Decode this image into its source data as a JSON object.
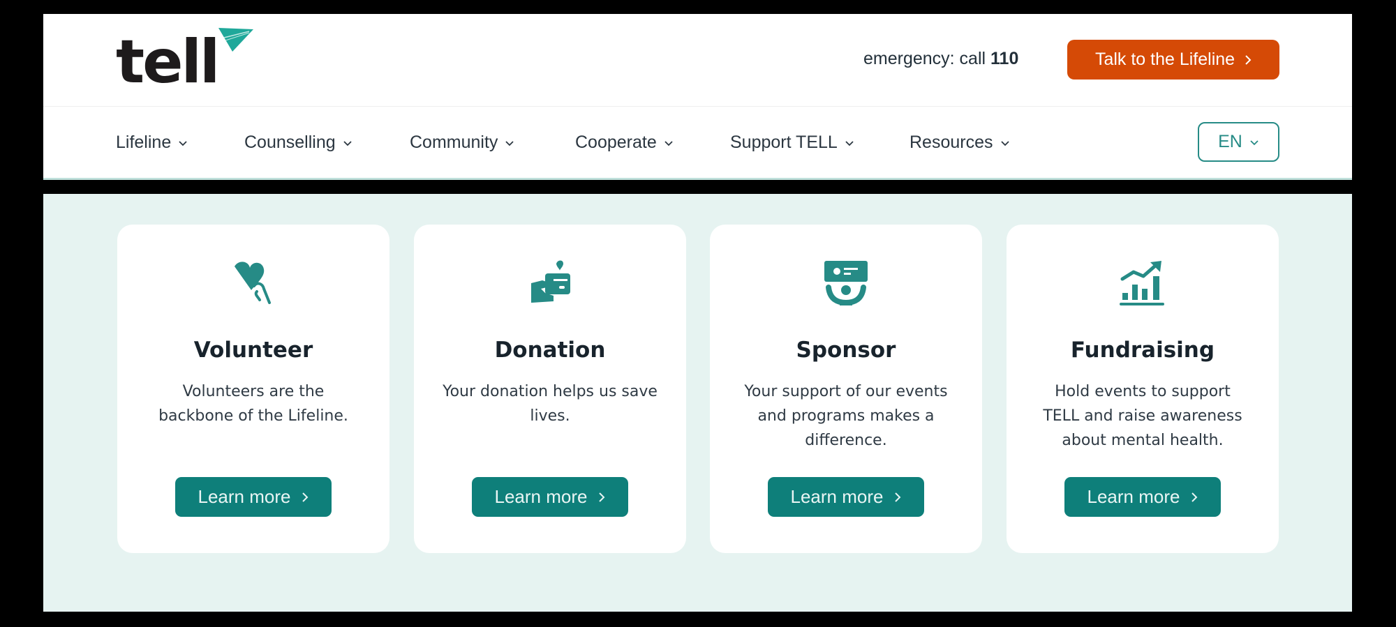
{
  "brand": {
    "logo_text": "tell",
    "accent": "#1fa89a",
    "primary": "#0e7f7a",
    "cta_color": "#d54a06"
  },
  "header": {
    "emergency_prefix": "emergency: call ",
    "emergency_number": "110",
    "cta_label": "Talk to the Lifeline",
    "cta_icon": "chevron-right-icon",
    "language": "EN"
  },
  "nav": {
    "items": [
      {
        "label": "Lifeline"
      },
      {
        "label": "Counselling"
      },
      {
        "label": "Community"
      },
      {
        "label": "Cooperate"
      },
      {
        "label": "Support TELL"
      },
      {
        "label": "Resources"
      }
    ]
  },
  "cards": [
    {
      "icon": "heart-in-hand-icon",
      "title": "Volunteer",
      "description": "Volunteers are the backbone of the Lifeline.",
      "button": "Learn more"
    },
    {
      "icon": "donation-card-icon",
      "title": "Donation",
      "description": "Your donation helps us save lives.",
      "button": "Learn more"
    },
    {
      "icon": "sponsor-icon",
      "title": "Sponsor",
      "description": "Your support of our events and programs makes a difference.",
      "button": "Learn more"
    },
    {
      "icon": "growth-chart-icon",
      "title": "Fundraising",
      "description": "Hold events to support TELL and raise awareness about mental health.",
      "button": "Learn more"
    }
  ]
}
